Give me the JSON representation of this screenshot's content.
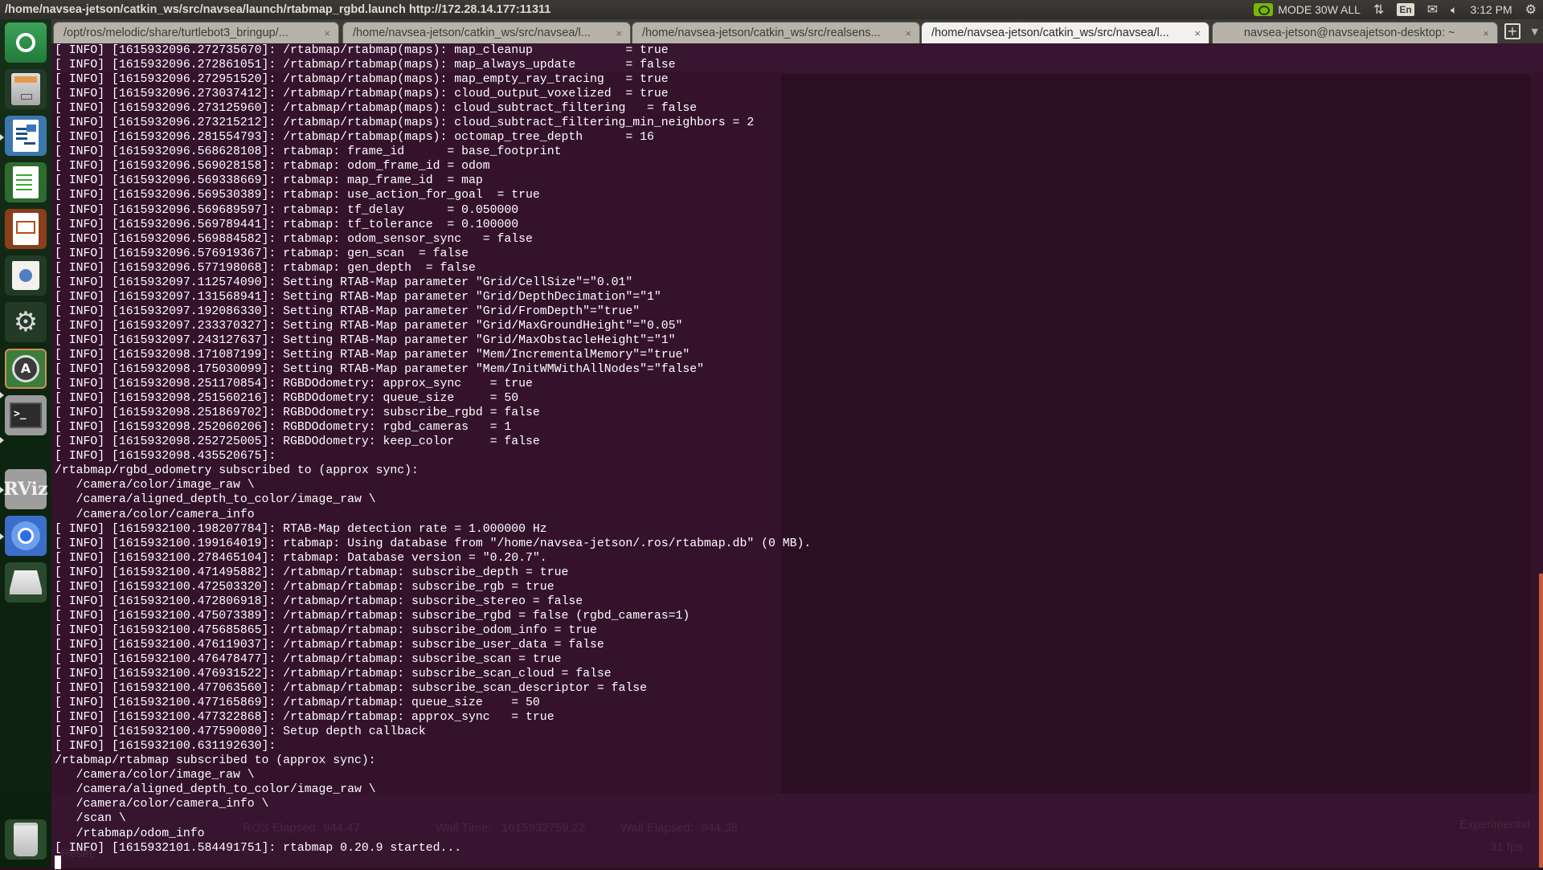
{
  "window_title": "/home/navsea-jetson/catkin_ws/src/navsea/launch/rtabmap_rgbd.launch http://172.28.14.177:11311",
  "indicators": {
    "nvidia_mode": "MODE 30W ALL",
    "keyboard_layout": "En",
    "clock": "3:12 PM"
  },
  "launcher": {
    "items": [
      {
        "name": "ubuntu-dash"
      },
      {
        "name": "files"
      },
      {
        "name": "libreoffice-writer"
      },
      {
        "name": "libreoffice-calc"
      },
      {
        "name": "libreoffice-impress"
      },
      {
        "name": "ubuntu-software"
      },
      {
        "name": "system-settings"
      },
      {
        "name": "software-updater"
      },
      {
        "name": "terminal"
      },
      {
        "name": "rviz",
        "label": "RViz"
      },
      {
        "name": "chromium"
      },
      {
        "name": "drive"
      },
      {
        "name": "trash"
      }
    ]
  },
  "tabs": [
    {
      "label": "/opt/ros/melodic/share/turtlebot3_bringup/...",
      "active": false
    },
    {
      "label": "/home/navsea-jetson/catkin_ws/src/navsea/l...",
      "active": false
    },
    {
      "label": "/home/navsea-jetson/catkin_ws/src/realsens...",
      "active": false
    },
    {
      "label": "/home/navsea-jetson/catkin_ws/src/navsea/l...",
      "active": true
    },
    {
      "label": "navsea-jetson@navseajetson-desktop: ~",
      "active": false
    }
  ],
  "tab_close_glyph": "×",
  "background_rviz": {
    "ros_elapsed_label": "ROS Elapsed:",
    "ros_elapsed": "944.47",
    "wall_time_label": "Wall Time:",
    "wall_time": "1615932759.22",
    "wall_elapsed_label": "Wall Elapsed:",
    "wall_elapsed": "944.38",
    "experimental_label": "Experimental",
    "fps": "31 fps",
    "reset_label": "Reset"
  },
  "terminal_lines": [
    "[ INFO] [1615932096.272735670]: /rtabmap/rtabmap(maps): map_cleanup             = true",
    "[ INFO] [1615932096.272861051]: /rtabmap/rtabmap(maps): map_always_update       = false",
    "[ INFO] [1615932096.272951520]: /rtabmap/rtabmap(maps): map_empty_ray_tracing   = true",
    "[ INFO] [1615932096.273037412]: /rtabmap/rtabmap(maps): cloud_output_voxelized  = true",
    "[ INFO] [1615932096.273125960]: /rtabmap/rtabmap(maps): cloud_subtract_filtering   = false",
    "[ INFO] [1615932096.273215212]: /rtabmap/rtabmap(maps): cloud_subtract_filtering_min_neighbors = 2",
    "[ INFO] [1615932096.281554793]: /rtabmap/rtabmap(maps): octomap_tree_depth      = 16",
    "[ INFO] [1615932096.568628108]: rtabmap: frame_id      = base_footprint",
    "[ INFO] [1615932096.569028158]: rtabmap: odom_frame_id = odom",
    "[ INFO] [1615932096.569338669]: rtabmap: map_frame_id  = map",
    "[ INFO] [1615932096.569530389]: rtabmap: use_action_for_goal  = true",
    "[ INFO] [1615932096.569689597]: rtabmap: tf_delay      = 0.050000",
    "[ INFO] [1615932096.569789441]: rtabmap: tf_tolerance  = 0.100000",
    "[ INFO] [1615932096.569884582]: rtabmap: odom_sensor_sync   = false",
    "[ INFO] [1615932096.576919367]: rtabmap: gen_scan  = false",
    "[ INFO] [1615932096.577198068]: rtabmap: gen_depth  = false",
    "[ INFO] [1615932097.112574090]: Setting RTAB-Map parameter \"Grid/CellSize\"=\"0.01\"",
    "[ INFO] [1615932097.131568941]: Setting RTAB-Map parameter \"Grid/DepthDecimation\"=\"1\"",
    "[ INFO] [1615932097.192086330]: Setting RTAB-Map parameter \"Grid/FromDepth\"=\"true\"",
    "[ INFO] [1615932097.233370327]: Setting RTAB-Map parameter \"Grid/MaxGroundHeight\"=\"0.05\"",
    "[ INFO] [1615932097.243127637]: Setting RTAB-Map parameter \"Grid/MaxObstacleHeight\"=\"1\"",
    "[ INFO] [1615932098.171087199]: Setting RTAB-Map parameter \"Mem/IncrementalMemory\"=\"true\"",
    "[ INFO] [1615932098.175030099]: Setting RTAB-Map parameter \"Mem/InitWMWithAllNodes\"=\"false\"",
    "[ INFO] [1615932098.251170854]: RGBDOdometry: approx_sync    = true",
    "[ INFO] [1615932098.251560216]: RGBDOdometry: queue_size     = 50",
    "[ INFO] [1615932098.251869702]: RGBDOdometry: subscribe_rgbd = false",
    "[ INFO] [1615932098.252060206]: RGBDOdometry: rgbd_cameras   = 1",
    "[ INFO] [1615932098.252725005]: RGBDOdometry: keep_color     = false",
    "[ INFO] [1615932098.435520675]: ",
    "/rtabmap/rgbd_odometry subscribed to (approx sync):",
    "   /camera/color/image_raw \\",
    "   /camera/aligned_depth_to_color/image_raw \\",
    "   /camera/color/camera_info",
    "[ INFO] [1615932100.198207784]: RTAB-Map detection rate = 1.000000 Hz",
    "[ INFO] [1615932100.199164019]: rtabmap: Using database from \"/home/navsea-jetson/.ros/rtabmap.db\" (0 MB).",
    "[ INFO] [1615932100.278465104]: rtabmap: Database version = \"0.20.7\".",
    "[ INFO] [1615932100.471495882]: /rtabmap/rtabmap: subscribe_depth = true",
    "[ INFO] [1615932100.472503320]: /rtabmap/rtabmap: subscribe_rgb = true",
    "[ INFO] [1615932100.472806918]: /rtabmap/rtabmap: subscribe_stereo = false",
    "[ INFO] [1615932100.475073389]: /rtabmap/rtabmap: subscribe_rgbd = false (rgbd_cameras=1)",
    "[ INFO] [1615932100.475685865]: /rtabmap/rtabmap: subscribe_odom_info = true",
    "[ INFO] [1615932100.476119037]: /rtabmap/rtabmap: subscribe_user_data = false",
    "[ INFO] [1615932100.476478477]: /rtabmap/rtabmap: subscribe_scan = true",
    "[ INFO] [1615932100.476931522]: /rtabmap/rtabmap: subscribe_scan_cloud = false",
    "[ INFO] [1615932100.477063560]: /rtabmap/rtabmap: subscribe_scan_descriptor = false",
    "[ INFO] [1615932100.477165869]: /rtabmap/rtabmap: queue_size    = 50",
    "[ INFO] [1615932100.477322868]: /rtabmap/rtabmap: approx_sync   = true",
    "[ INFO] [1615932100.477590080]: Setup depth callback",
    "[ INFO] [1615932100.631192630]: ",
    "/rtabmap/rtabmap subscribed to (approx sync):",
    "   /camera/color/image_raw \\",
    "   /camera/aligned_depth_to_color/image_raw \\",
    "   /camera/color/camera_info \\",
    "   /scan \\",
    "   /rtabmap/odom_info",
    "[ INFO] [1615932101.584491751]: rtabmap 0.20.9 started..."
  ],
  "colors": {
    "terminal_bg": "#34122c",
    "terminal_fg": "#ffffff",
    "scrollbar_thumb": "#c85a3a",
    "nvidia_green": "#76b900"
  }
}
